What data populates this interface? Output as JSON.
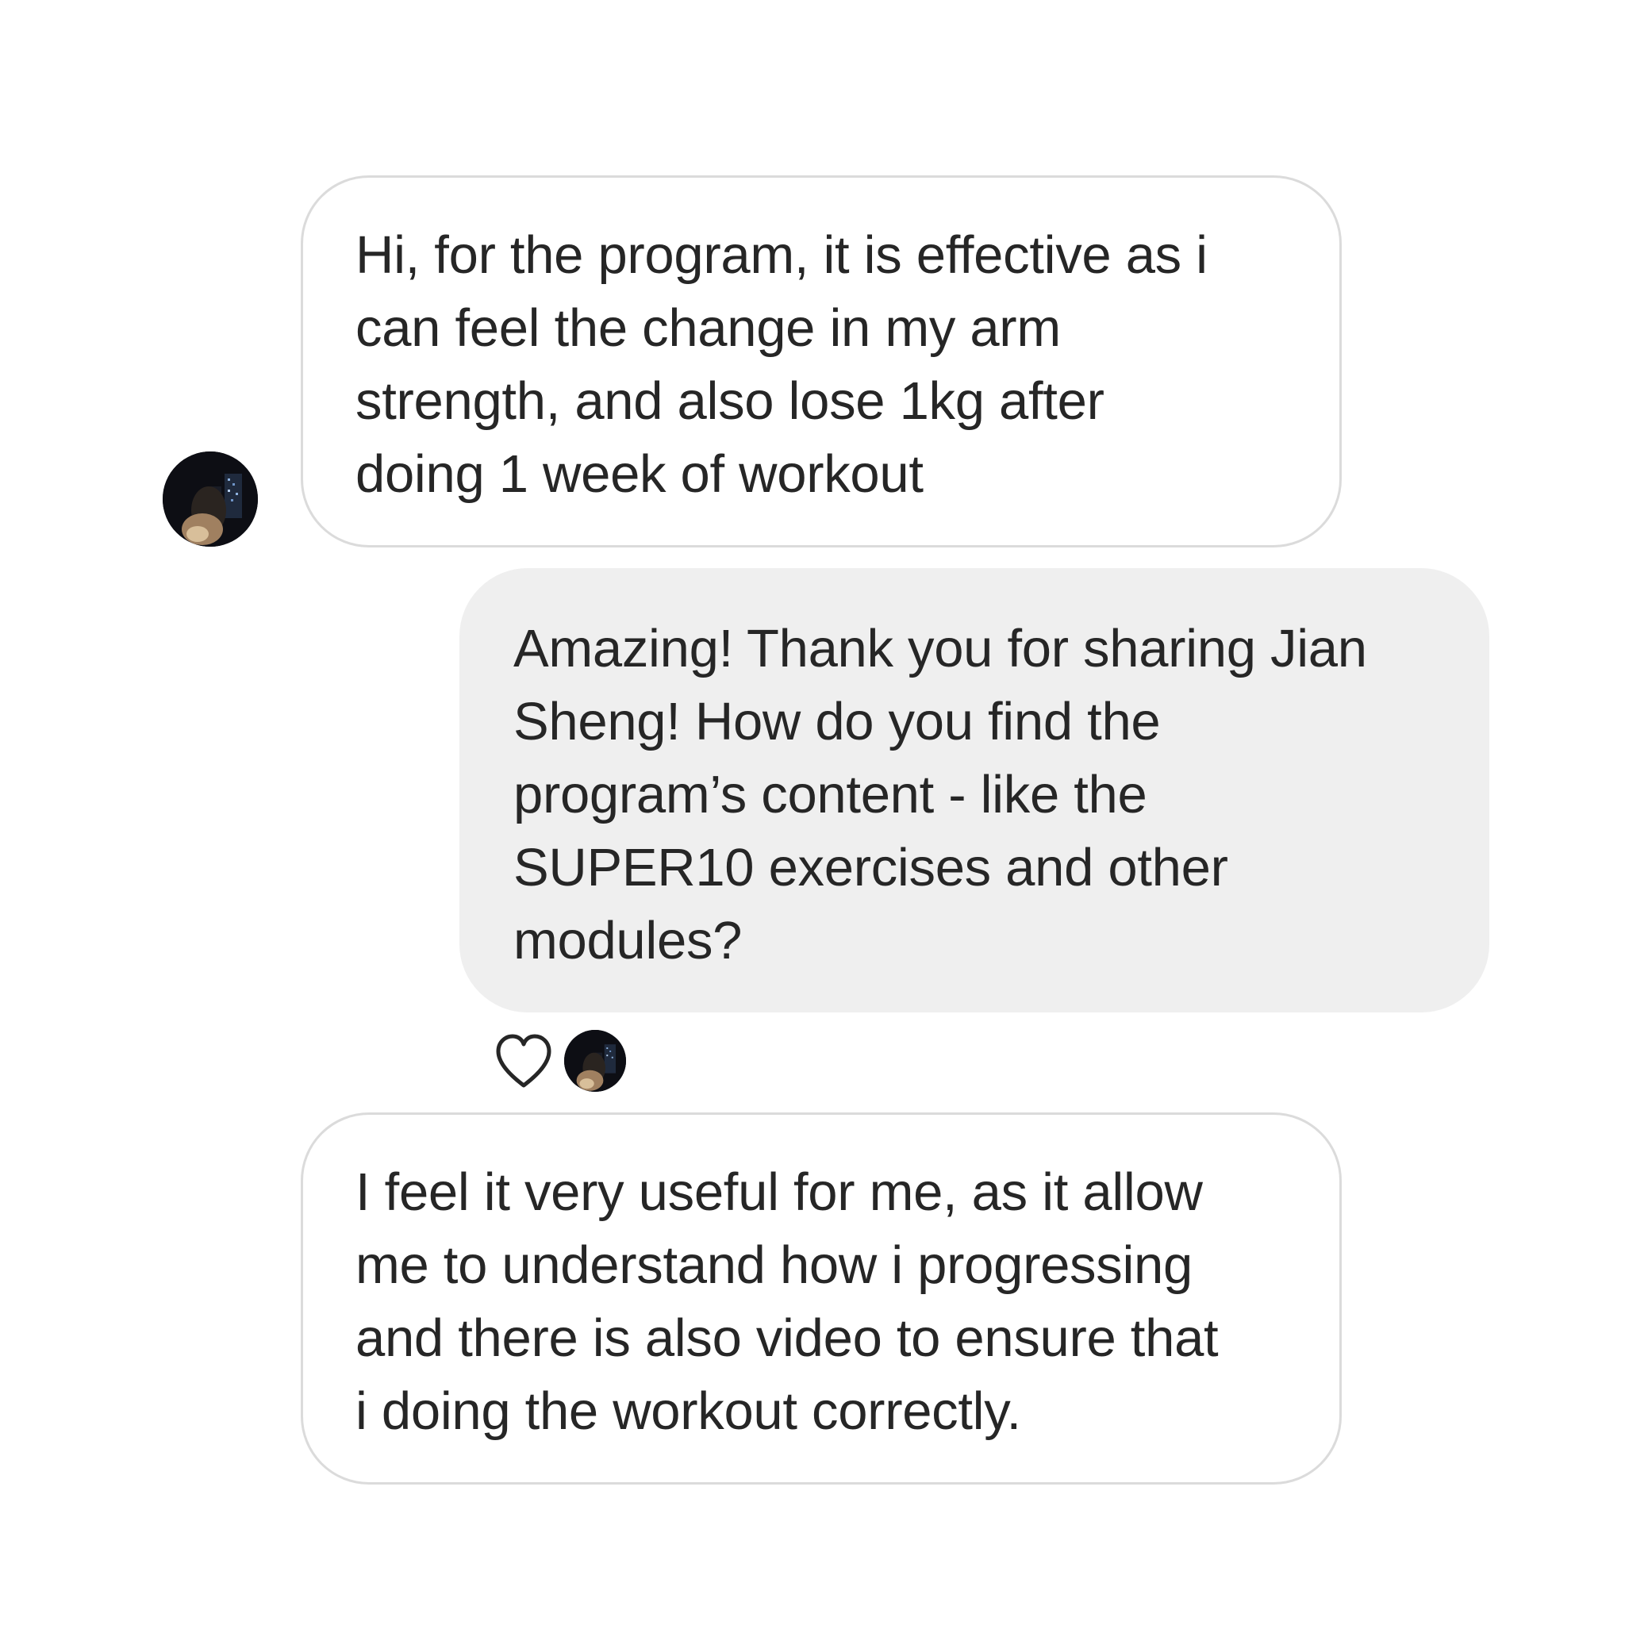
{
  "messages": [
    {
      "sender": "other",
      "text": "Hi, for the program, it is effective as i\ncan feel the change in my arm\nstrength, and also lose 1kg after\ndoing 1 week of workout"
    },
    {
      "sender": "me",
      "text": "Amazing! Thank you for sharing Jian\nSheng! How do you find the\nprogram’s content - like the\nSUPER10 exercises and other\nmodules?"
    },
    {
      "sender": "other",
      "text": "I feel it very useful for me, as it allow\nme to understand how i progressing\nand there is also video to ensure that\ni doing the workout correctly."
    }
  ],
  "reaction": {
    "icon": "heart-outline-icon"
  },
  "colors": {
    "incoming_bubble_border": "#dbdbdb",
    "outgoing_bubble_fill": "#efefef",
    "text": "#262626"
  }
}
